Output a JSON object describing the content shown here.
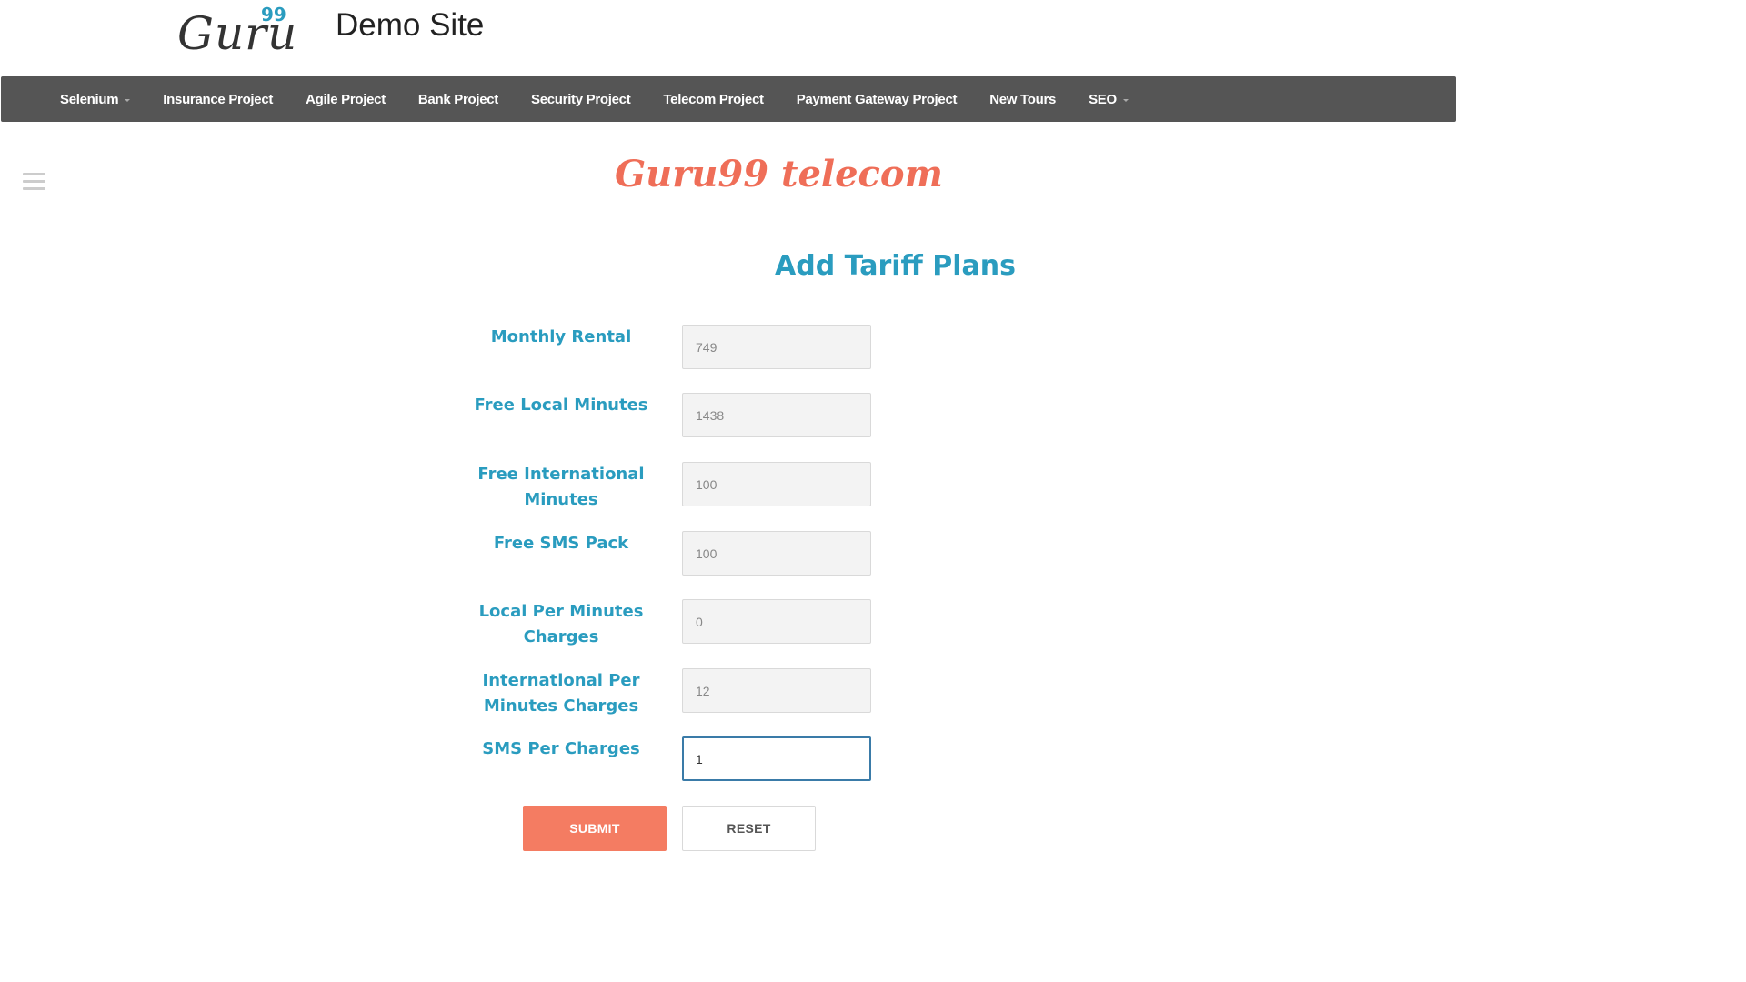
{
  "header": {
    "logo_text": "Guru",
    "logo_superscript": "99",
    "site_title": "Demo Site"
  },
  "nav": {
    "items": [
      {
        "label": "Selenium",
        "dropdown": true
      },
      {
        "label": "Insurance Project",
        "dropdown": false
      },
      {
        "label": "Agile Project",
        "dropdown": false
      },
      {
        "label": "Bank Project",
        "dropdown": false
      },
      {
        "label": "Security Project",
        "dropdown": false
      },
      {
        "label": "Telecom Project",
        "dropdown": false
      },
      {
        "label": "Payment Gateway Project",
        "dropdown": false
      },
      {
        "label": "New Tours",
        "dropdown": false
      },
      {
        "label": "SEO",
        "dropdown": true
      }
    ]
  },
  "sidebar_toggle_icon": "hamburger-menu-icon",
  "brand": "Guru99 telecom",
  "page_heading": "Add Tariff Plans",
  "form": {
    "fields": [
      {
        "label": "Monthly Rental",
        "value": "749"
      },
      {
        "label": "Free Local Minutes",
        "value": "1438"
      },
      {
        "label": "Free International Minutes",
        "value": "100"
      },
      {
        "label": "Free SMS Pack",
        "value": "100"
      },
      {
        "label": "Local Per Minutes Charges",
        "value": "0"
      },
      {
        "label": "International Per Minutes Charges",
        "value": "12"
      },
      {
        "label": "SMS Per Charges",
        "value": "1",
        "focused": true
      }
    ],
    "submit_label": "SUBMIT",
    "reset_label": "RESET"
  },
  "colors": {
    "nav_background": "#555555",
    "label_blue": "#2a9cbf",
    "brand_coral": "#ef6e58",
    "submit_coral": "#f47c62",
    "focus_border": "#3a7ba8"
  }
}
